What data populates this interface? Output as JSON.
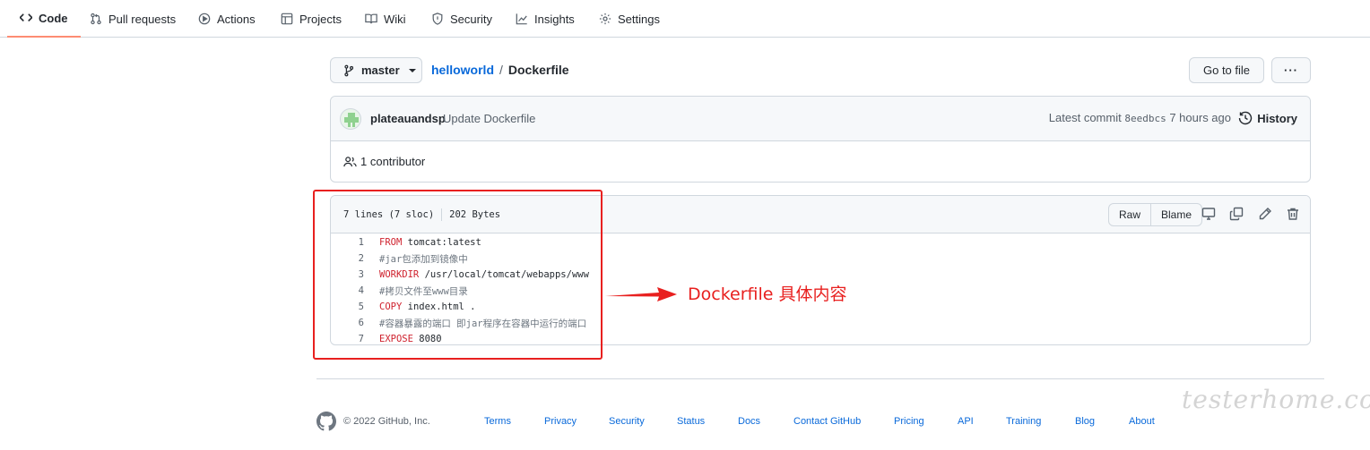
{
  "nav": {
    "tabs": [
      {
        "label": "Code",
        "icon": "code-icon",
        "active": true
      },
      {
        "label": "Pull requests",
        "icon": "pull-request-icon"
      },
      {
        "label": "Actions",
        "icon": "play-icon"
      },
      {
        "label": "Projects",
        "icon": "table-icon"
      },
      {
        "label": "Wiki",
        "icon": "book-icon"
      },
      {
        "label": "Security",
        "icon": "shield-icon"
      },
      {
        "label": "Insights",
        "icon": "graph-icon"
      },
      {
        "label": "Settings",
        "icon": "gear-icon"
      }
    ]
  },
  "breadcrumb": {
    "branch": "master",
    "repo": "helloworld",
    "separator": "/",
    "file": "Dockerfile"
  },
  "actions": {
    "go_to_file": "Go to file",
    "more": "···"
  },
  "commit": {
    "author": "plateauandsp",
    "message": "Update Dockerfile",
    "latest_label": "Latest commit",
    "sha": "8eedbcs",
    "time": "7 hours ago",
    "history": "History",
    "contributors": "1 contributor"
  },
  "file": {
    "lines_info": "7 lines (7 sloc)",
    "size": "202 Bytes",
    "raw": "Raw",
    "blame": "Blame",
    "code": [
      {
        "n": "1",
        "kw": "FROM",
        "rest": " tomcat:latest",
        "comment": false
      },
      {
        "n": "2",
        "kw": "",
        "rest": "#jar包添加到镜像中",
        "comment": true
      },
      {
        "n": "3",
        "kw": "WORKDIR",
        "rest": " /usr/local/tomcat/webapps/www",
        "comment": false
      },
      {
        "n": "4",
        "kw": "",
        "rest": "#拷贝文件至www目录",
        "comment": true
      },
      {
        "n": "5",
        "kw": "COPY",
        "rest": " index.html .",
        "comment": false
      },
      {
        "n": "6",
        "kw": "",
        "rest": "#容器暴露的端口 即jar程序在容器中运行的端口",
        "comment": true
      },
      {
        "n": "7",
        "kw": "EXPOSE",
        "rest": " 8080",
        "comment": false
      }
    ]
  },
  "annotation": {
    "text": "Dockerfile 具体内容",
    "color": "#e8201f"
  },
  "footer": {
    "copyright": "© 2022 GitHub, Inc.",
    "links": [
      "Terms",
      "Privacy",
      "Security",
      "Status",
      "Docs",
      "Contact GitHub",
      "Pricing",
      "API",
      "Training",
      "Blog",
      "About"
    ]
  },
  "watermark": "testerhome.com",
  "colors": {
    "accent": "#0969da",
    "active_tab": "#fd8c73",
    "keyword": "#cf222e",
    "border": "#d0d7de"
  }
}
